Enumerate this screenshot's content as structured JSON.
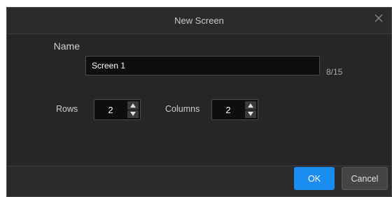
{
  "dialog": {
    "title": "New Screen",
    "close_icon": "close-icon"
  },
  "form": {
    "name_label": "Name",
    "name_value": "Screen 1",
    "name_counter": "8/15",
    "rows_label": "Rows",
    "rows_value": "2",
    "columns_label": "Columns",
    "columns_value": "2"
  },
  "footer": {
    "ok_label": "OK",
    "cancel_label": "Cancel"
  },
  "colors": {
    "dialog_bg": "#2b2b2d",
    "input_bg": "#0e0e0f",
    "accent": "#1a8cf0"
  }
}
